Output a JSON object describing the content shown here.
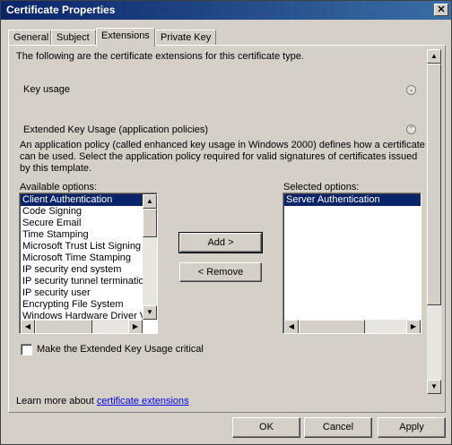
{
  "window": {
    "title": "Certificate Properties"
  },
  "tabs": [
    {
      "label": "General"
    },
    {
      "label": "Subject"
    },
    {
      "label": "Extensions"
    },
    {
      "label": "Private Key"
    }
  ],
  "extensions": {
    "intro": "The following are the certificate extensions for this certificate type.",
    "key_usage_label": "Key usage",
    "eku_label": "Extended Key Usage (application policies)",
    "description_lines": [
      "An application policy (called enhanced key usage in Windows 2000) defines how a certificate",
      "can be used. Select the application policy required for valid signatures of certificates issued",
      "by this template."
    ],
    "available_label": "Available options:",
    "selected_label": "Selected options:",
    "available_options": [
      "Client Authentication",
      "Code Signing",
      "Secure Email",
      "Time Stamping",
      "Microsoft Trust List Signing",
      "Microsoft Time Stamping",
      "IP security end system",
      "IP security tunnel termination",
      "IP security user",
      "Encrypting File System",
      "Windows Hardware Driver Verification"
    ],
    "available_selected": "Client Authentication",
    "selected_options": [
      "Server Authentication"
    ],
    "add_button": "Add >",
    "remove_button": "< Remove",
    "critical_checkbox_label": "Make the Extended Key Usage critical",
    "critical_checked": false,
    "learn_more_prefix": "Learn more about",
    "learn_more_link": "certificate extensions"
  },
  "footer": {
    "ok": "OK",
    "cancel": "Cancel",
    "apply": "Apply"
  }
}
